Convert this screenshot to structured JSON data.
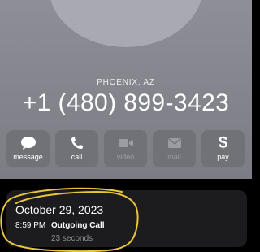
{
  "contact": {
    "location": "PHOENIX, AZ",
    "phone_number": "+1 (480) 899-3423"
  },
  "actions": [
    {
      "label": "message",
      "icon": "message-bubble-icon",
      "enabled": true
    },
    {
      "label": "call",
      "icon": "phone-icon",
      "enabled": true
    },
    {
      "label": "video",
      "icon": "video-camera-icon",
      "enabled": false
    },
    {
      "label": "mail",
      "icon": "mail-envelope-icon",
      "enabled": false
    },
    {
      "label": "pay",
      "icon": "dollar-sign-icon",
      "enabled": true
    }
  ],
  "call_history": {
    "date": "October 29, 2023",
    "entries": [
      {
        "time": "8:59 PM",
        "type": "Outgoing Call",
        "duration": "23 seconds"
      }
    ]
  },
  "colors": {
    "header_background": "#84848c",
    "card_background": "#1c1c1e",
    "highlight_annotation": "#e8c53a"
  }
}
